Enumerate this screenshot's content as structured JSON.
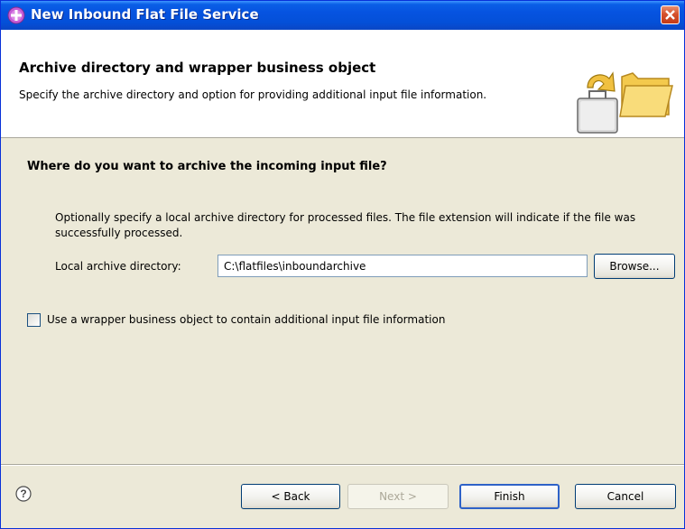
{
  "window": {
    "title": "New Inbound Flat File Service",
    "title_icon": "plus-circle-icon",
    "close_icon": "close-icon"
  },
  "header": {
    "title": "Archive directory and wrapper business object",
    "description": "Specify the archive directory and option for providing additional input file information.",
    "icon": "archive-folder-icon"
  },
  "section": {
    "title": "Where do you want to archive the incoming input file?",
    "description": "Optionally specify a local archive directory for processed files.  The file extension will indicate if the file was successfully processed.",
    "field_label": "Local archive directory:",
    "field_value": "C:\\flatfiles\\inboundarchive",
    "browse_label": "Browse..."
  },
  "wrapper": {
    "checkbox_label": "Use a wrapper business object to contain additional input file information",
    "checked": false
  },
  "footer": {
    "help_icon": "help-icon",
    "back_label": "< Back",
    "next_label": "Next >",
    "finish_label": "Finish",
    "cancel_label": "Cancel"
  },
  "colors": {
    "titlebar": "#0653e0",
    "dialog_bg": "#ece9d8",
    "close_button": "#d5512d"
  }
}
